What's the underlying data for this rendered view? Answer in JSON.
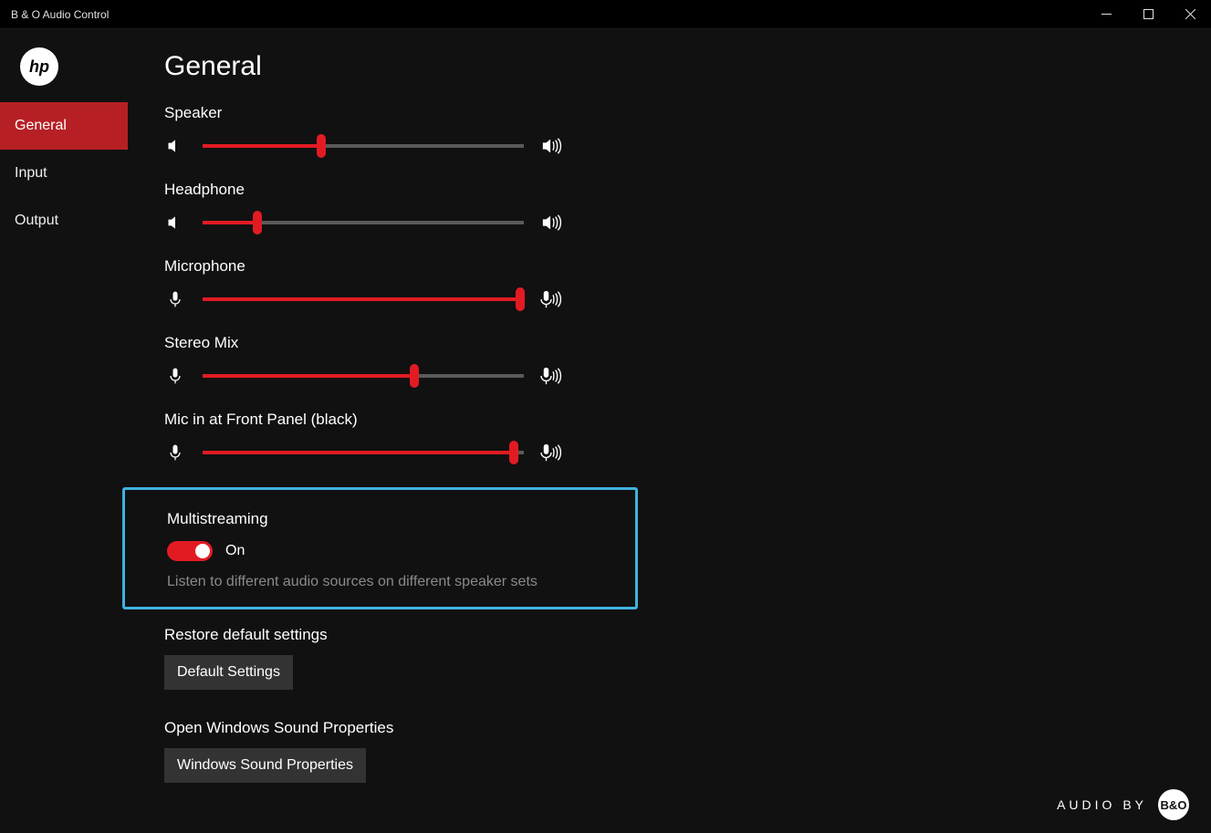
{
  "window": {
    "title": "B & O Audio Control"
  },
  "logo": {
    "text": "hp"
  },
  "sidebar": {
    "items": [
      {
        "label": "General",
        "active": true
      },
      {
        "label": "Input",
        "active": false
      },
      {
        "label": "Output",
        "active": false
      }
    ]
  },
  "page": {
    "title": "General",
    "sliders": [
      {
        "label": "Speaker",
        "value": 37,
        "left_icon": "speaker-low",
        "right_icon": "speaker-high"
      },
      {
        "label": "Headphone",
        "value": 17,
        "left_icon": "speaker-low",
        "right_icon": "speaker-high"
      },
      {
        "label": "Microphone",
        "value": 99,
        "left_icon": "mic",
        "right_icon": "mic-wave"
      },
      {
        "label": "Stereo Mix",
        "value": 66,
        "left_icon": "mic",
        "right_icon": "mic-wave"
      },
      {
        "label": "Mic in at Front Panel (black)",
        "value": 97,
        "left_icon": "mic",
        "right_icon": "mic-wave"
      }
    ],
    "multistream": {
      "title": "Multistreaming",
      "state": "On",
      "description": "Listen to different audio sources on different speaker sets"
    },
    "restore": {
      "title": "Restore default settings",
      "button": "Default Settings"
    },
    "sound_props": {
      "title": "Open Windows Sound Properties",
      "button": "Windows Sound Properties"
    }
  },
  "footer": {
    "audio_by": "AUDIO BY",
    "brand": "B&O"
  }
}
